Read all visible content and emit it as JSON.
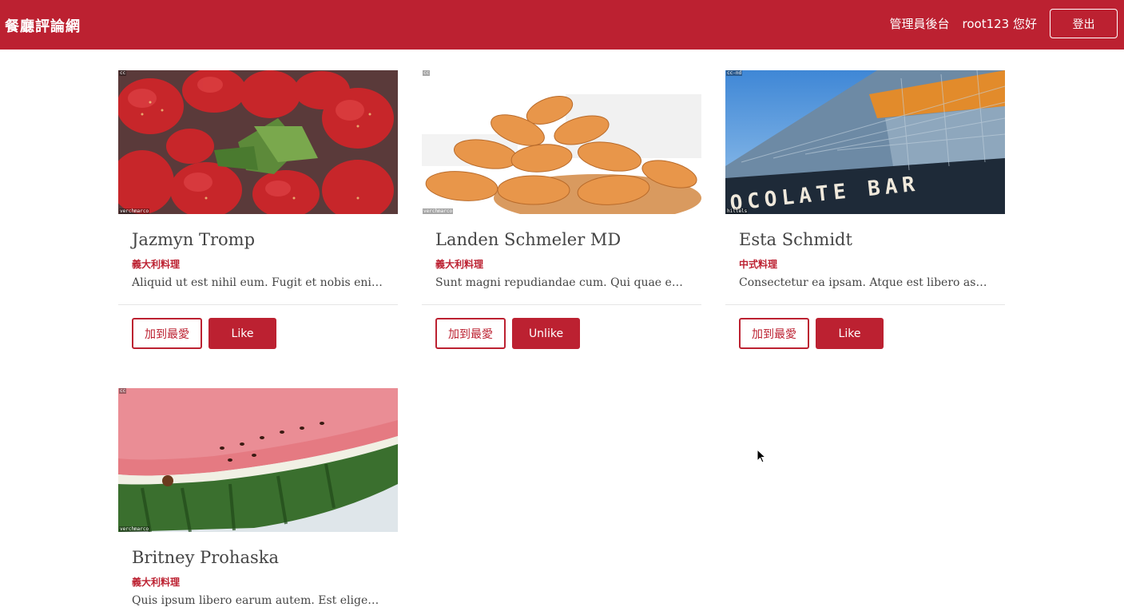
{
  "navbar": {
    "brand": "餐廳評論網",
    "admin_link": "管理員後台",
    "greeting": "root123 您好",
    "logout_label": "登出"
  },
  "cards": [
    {
      "title": "Jazmyn Tromp",
      "category": "義大利料理",
      "description": "Aliquid ut est nihil eum. Fugit et nobis enim quo.",
      "image": "strawberries",
      "image_tag": "cc",
      "image_credit": "verchmarco",
      "favorite_label": "加到最愛",
      "like_label": "Like"
    },
    {
      "title": "Landen Schmeler MD",
      "category": "義大利料理",
      "description": "Sunt magni repudiandae cum. Qui quae ex dolor.",
      "image": "almonds",
      "image_tag": "cc",
      "image_credit": "verchmarco",
      "favorite_label": "加到最愛",
      "like_label": "Unlike"
    },
    {
      "title": "Esta Schmidt",
      "category": "中式料理",
      "description": "Consectetur ea ipsam. Atque est libero aspernatur.",
      "image": "chocolate-bar-building",
      "image_tag": "cc-nd",
      "image_credit": "hillels",
      "favorite_label": "加到最愛",
      "like_label": "Like"
    },
    {
      "title": "Britney Prohaska",
      "category": "義大利料理",
      "description": "Quis ipsum libero earum autem. Est eligendi quia.",
      "image": "watermelon",
      "image_tag": "cc",
      "image_credit": "verchmarco",
      "favorite_label": "加到最愛",
      "like_label": "Like"
    }
  ],
  "colors": {
    "brand": "#bc2131"
  },
  "building_sign": "OCOLATE BAR"
}
